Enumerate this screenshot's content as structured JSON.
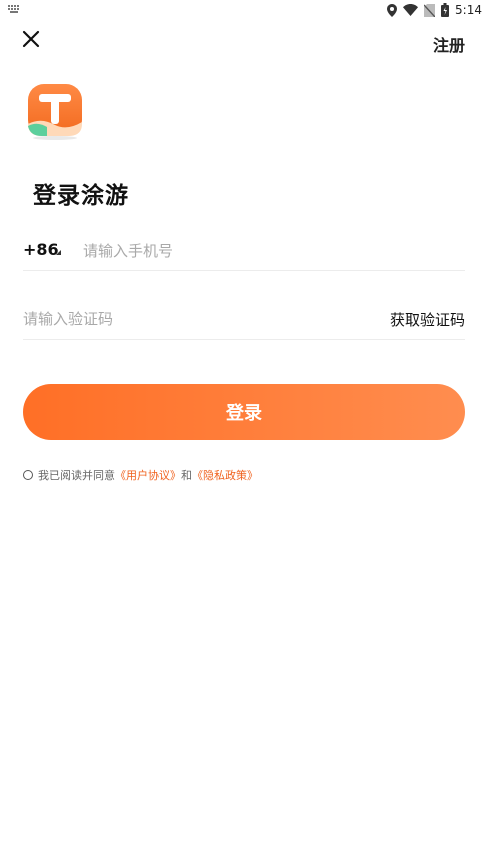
{
  "status_bar": {
    "time": "5:14",
    "icons": [
      "keyboard-icon",
      "location-icon",
      "wifi-icon",
      "no-sim-icon",
      "battery-icon"
    ]
  },
  "header": {
    "close_icon": "close-icon",
    "register_label": "注册"
  },
  "logo": {
    "letter": "T",
    "icon": "app-logo-icon"
  },
  "title": "登录涂游",
  "phone": {
    "country_code": "+86",
    "placeholder": "请输入手机号"
  },
  "code": {
    "placeholder": "请输入验证码",
    "get_code_label": "获取验证码"
  },
  "login_button": "登录",
  "agreement": {
    "prefix": "我已阅读并同意",
    "user_agreement": "《用户协议》",
    "conjunction": "和",
    "privacy_policy": "《隐私政策》"
  },
  "colors": {
    "accent": "#ff6f26",
    "accent_light": "#ff8d4f",
    "link": "#f0621e",
    "logo_teal": "#5ccf9c"
  }
}
